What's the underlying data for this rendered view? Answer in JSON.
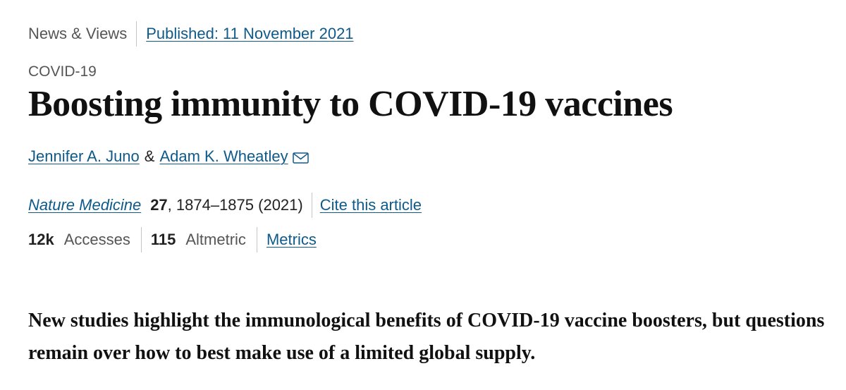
{
  "article": {
    "type": "News & Views",
    "published": "Published: 11 November 2021",
    "subject": "COVID-19",
    "title": "Boosting immunity to COVID-19 vaccines",
    "authors": [
      {
        "name": "Jennifer A. Juno"
      },
      {
        "name": "Adam K. Wheatley"
      }
    ],
    "author_separator": "&",
    "citation": {
      "journal": "Nature Medicine",
      "volume": "27",
      "pages_year": ", 1874–1875 (2021)",
      "cite_label": "Cite this article"
    },
    "metrics": {
      "accesses_value": "12k",
      "accesses_label": "Accesses",
      "altmetric_value": "115",
      "altmetric_label": "Altmetric",
      "metrics_link": "Metrics"
    },
    "standfirst": "New studies highlight the immunological benefits of COVID-19 vaccine boosters, but questions remain over how to best make use of a limited global supply."
  },
  "icons": {
    "mail": "mail-icon"
  },
  "colors": {
    "link": "#0e5a8a",
    "text": "#222222",
    "muted": "#555555"
  }
}
